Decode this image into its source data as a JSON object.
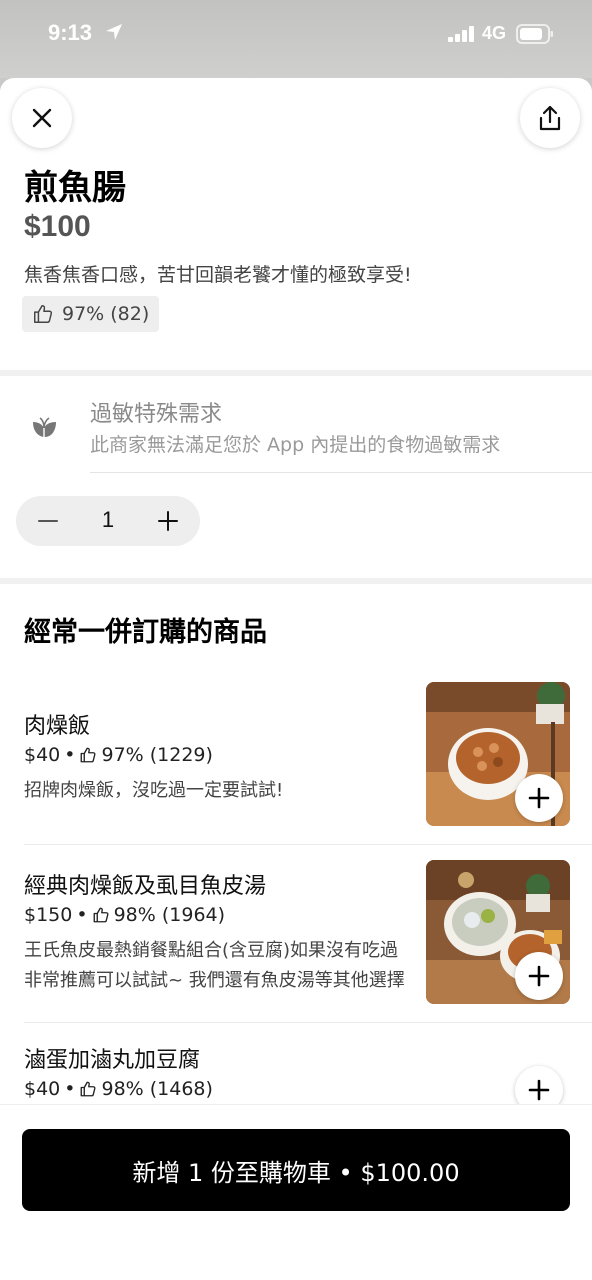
{
  "status": {
    "time": "9:13",
    "network": "4G"
  },
  "item": {
    "title": "煎魚腸",
    "price": "$100",
    "description": "焦香焦香口感，苦甘回韻老饕才懂的極致享受!",
    "rating": "97% (82)"
  },
  "allergy": {
    "title": "過敏特殊需求",
    "subtitle": "此商家無法滿足您於 App 內提出的食物過敏需求"
  },
  "quantity": "1",
  "frequently": {
    "title": "經常一併訂購的商品",
    "items": [
      {
        "name": "肉燥飯",
        "price": "$40",
        "rating": "97% (1229)",
        "description": "招牌肉燥飯，沒吃過一定要試試!"
      },
      {
        "name": "經典肉燥飯及虱目魚皮湯",
        "price": "$150",
        "rating": "98% (1964)",
        "description": "王氏魚皮最熱銷餐點組合(含豆腐)如果沒有吃過非常推薦可以試試~ 我們還有魚皮湯等其他選擇"
      },
      {
        "name": "滷蛋加滷丸加豆腐",
        "price": "$40",
        "rating": "98% (1468)",
        "description": ""
      }
    ]
  },
  "cart": {
    "label": "新增 1 份至購物車 • $100.00"
  },
  "icons": {
    "close": "close-icon",
    "share": "share-icon",
    "thumbs_up": "thumbs-up-icon",
    "allergy": "leaf-icon",
    "minus": "minus-icon",
    "plus": "plus-icon"
  }
}
